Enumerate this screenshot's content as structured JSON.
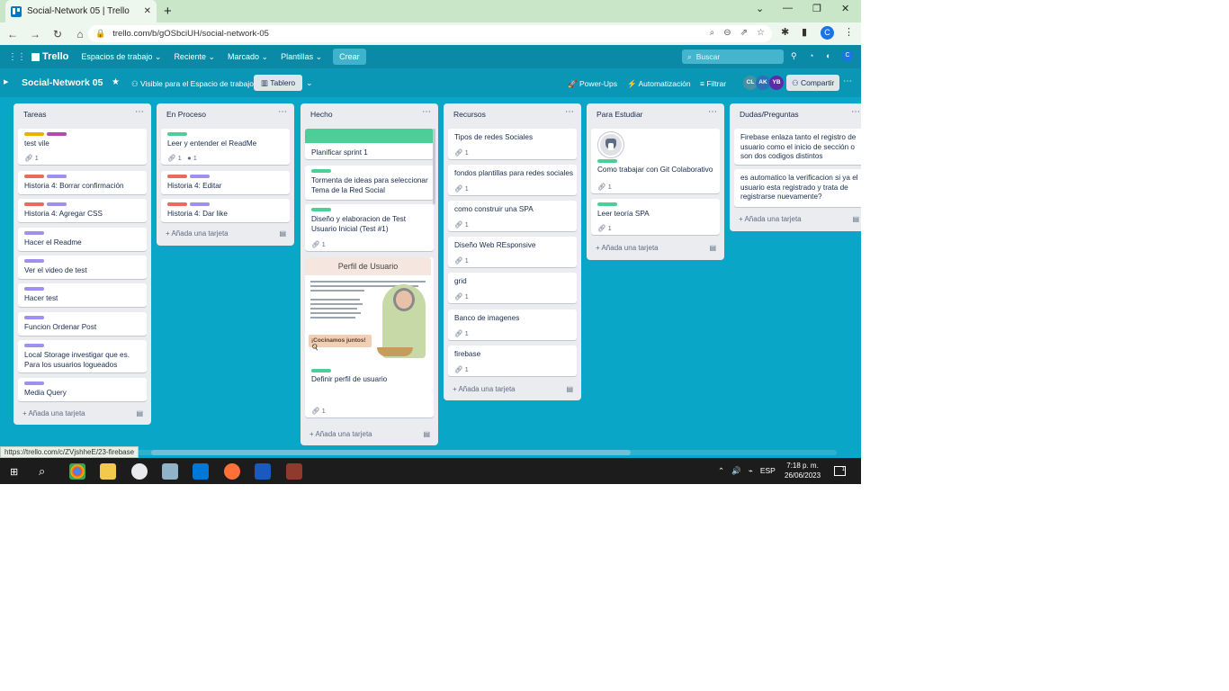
{
  "browser": {
    "tab_title": "Social-Network 05 | Trello",
    "tab_close": "✕",
    "new_tab": "+",
    "window_controls": [
      "⌄",
      "—",
      "❐",
      "✕"
    ],
    "url": "trello.com/b/gOSbciUH/social-network-05",
    "status_url": "https://trello.com/c/ZVjshheE/23-firebase"
  },
  "header": {
    "logo": "Trello",
    "nav": [
      "Espacios de trabajo ⌄",
      "Reciente ⌄",
      "Marcado ⌄",
      "Plantillas ⌄"
    ],
    "create": "Crear",
    "search_placeholder": "Buscar",
    "profile_initial": "C"
  },
  "board": {
    "title": "Social-Network 05",
    "visibility": "Visible para el Espacio de trabajo",
    "view": "Tablero",
    "powerups": "Power-Ups",
    "automation": "Automatización",
    "filter": "Filtrar",
    "share": "Compartir",
    "members": [
      {
        "initials": "CL",
        "color": "#4a90a4"
      },
      {
        "initials": "AK",
        "color": "#2b6fb5"
      },
      {
        "initials": "YB",
        "color": "#5b2ca8"
      }
    ]
  },
  "add_card": "Añada una tarjeta",
  "lists": [
    {
      "title": "Tareas",
      "cards": [
        {
          "labels": [
            "#e6b400",
            "#b04caa"
          ],
          "text": "test vile",
          "badge": "1"
        },
        {
          "labels": [
            "#e86b5c",
            "#9f8fef"
          ],
          "text": "Historia 4: Borrar confirmación"
        },
        {
          "labels": [
            "#e86b5c",
            "#9f8fef"
          ],
          "text": "Historia 4: Agregar CSS"
        },
        {
          "labels": [
            "#9f8fef"
          ],
          "text": "Hacer el Readme"
        },
        {
          "labels": [
            "#9f8fef"
          ],
          "text": "Ver el video de test"
        },
        {
          "labels": [
            "#9f8fef"
          ],
          "text": "Hacer test"
        },
        {
          "labels": [
            "#9f8fef"
          ],
          "text": "Funcion Ordenar Post"
        },
        {
          "labels": [
            "#9f8fef"
          ],
          "text": "Local Storage investigar que es. Para los usuarios logueados"
        },
        {
          "labels": [
            "#9f8fef"
          ],
          "text": "Media Query"
        }
      ]
    },
    {
      "title": "En Proceso",
      "cards": [
        {
          "labels": [
            "#4bce97"
          ],
          "text": "Leer y entender el ReadMe",
          "badge": "1",
          "github": "1"
        },
        {
          "labels": [
            "#e86b5c",
            "#9f8fef"
          ],
          "text": "Historia 4: Editar"
        },
        {
          "labels": [
            "#e86b5c",
            "#9f8fef"
          ],
          "text": "Historia 4: Dar like"
        }
      ]
    },
    {
      "title": "Hecho",
      "cards": [
        {
          "cover": "#4bce97",
          "text": "Planificar sprint 1"
        },
        {
          "labels": [
            "#4bce97"
          ],
          "text": "Tormenta de ideas para seleccionar Tema de la Red Social"
        },
        {
          "labels": [
            "#4bce97"
          ],
          "text": "Diseño y elaboracion de Test Usuario Inicial (Test #1)",
          "badge": "1"
        },
        {
          "image": {
            "title": "Perfil de Usuario",
            "cta": "¡Cocinamos juntos! 🍳"
          },
          "labels": [
            "#4bce97"
          ],
          "text": "Definir perfil de usuario",
          "badge": "1"
        }
      ]
    },
    {
      "title": "Recursos",
      "cards": [
        {
          "text": "Tipos de redes Sociales",
          "badge": "1"
        },
        {
          "text": "fondos plantillas para redes sociales",
          "badge": "1"
        },
        {
          "text": "como construir una SPA",
          "badge": "1"
        },
        {
          "text": "Diseño Web REsponsive",
          "badge": "1"
        },
        {
          "text": "grid",
          "badge": "1"
        },
        {
          "text": "Banco de imagenes",
          "badge": "1"
        },
        {
          "text": "firebase",
          "badge": "1"
        }
      ]
    },
    {
      "title": "Para Estudiar",
      "cards": [
        {
          "labels": [
            "#4bce97"
          ],
          "text": "Como trabajar con Git Colaborativo",
          "badge": "1",
          "thumb": "husky-icon"
        },
        {
          "labels": [
            "#4bce97"
          ],
          "text": "Leer teoría SPA",
          "badge": "1"
        }
      ]
    },
    {
      "title": "Dudas/Preguntas",
      "cards": [
        {
          "text": "Firebase enlaza tanto el registro de usuario como el inicio de sección o son dos codigos distintos"
        },
        {
          "text": "es automatico la verificacion si ya el usuario esta registrado y trata de registrarse nuevamente?"
        }
      ]
    }
  ],
  "taskbar": {
    "lang": "ESP",
    "time": "7:18 p. m.",
    "date": "26/06/2023"
  }
}
